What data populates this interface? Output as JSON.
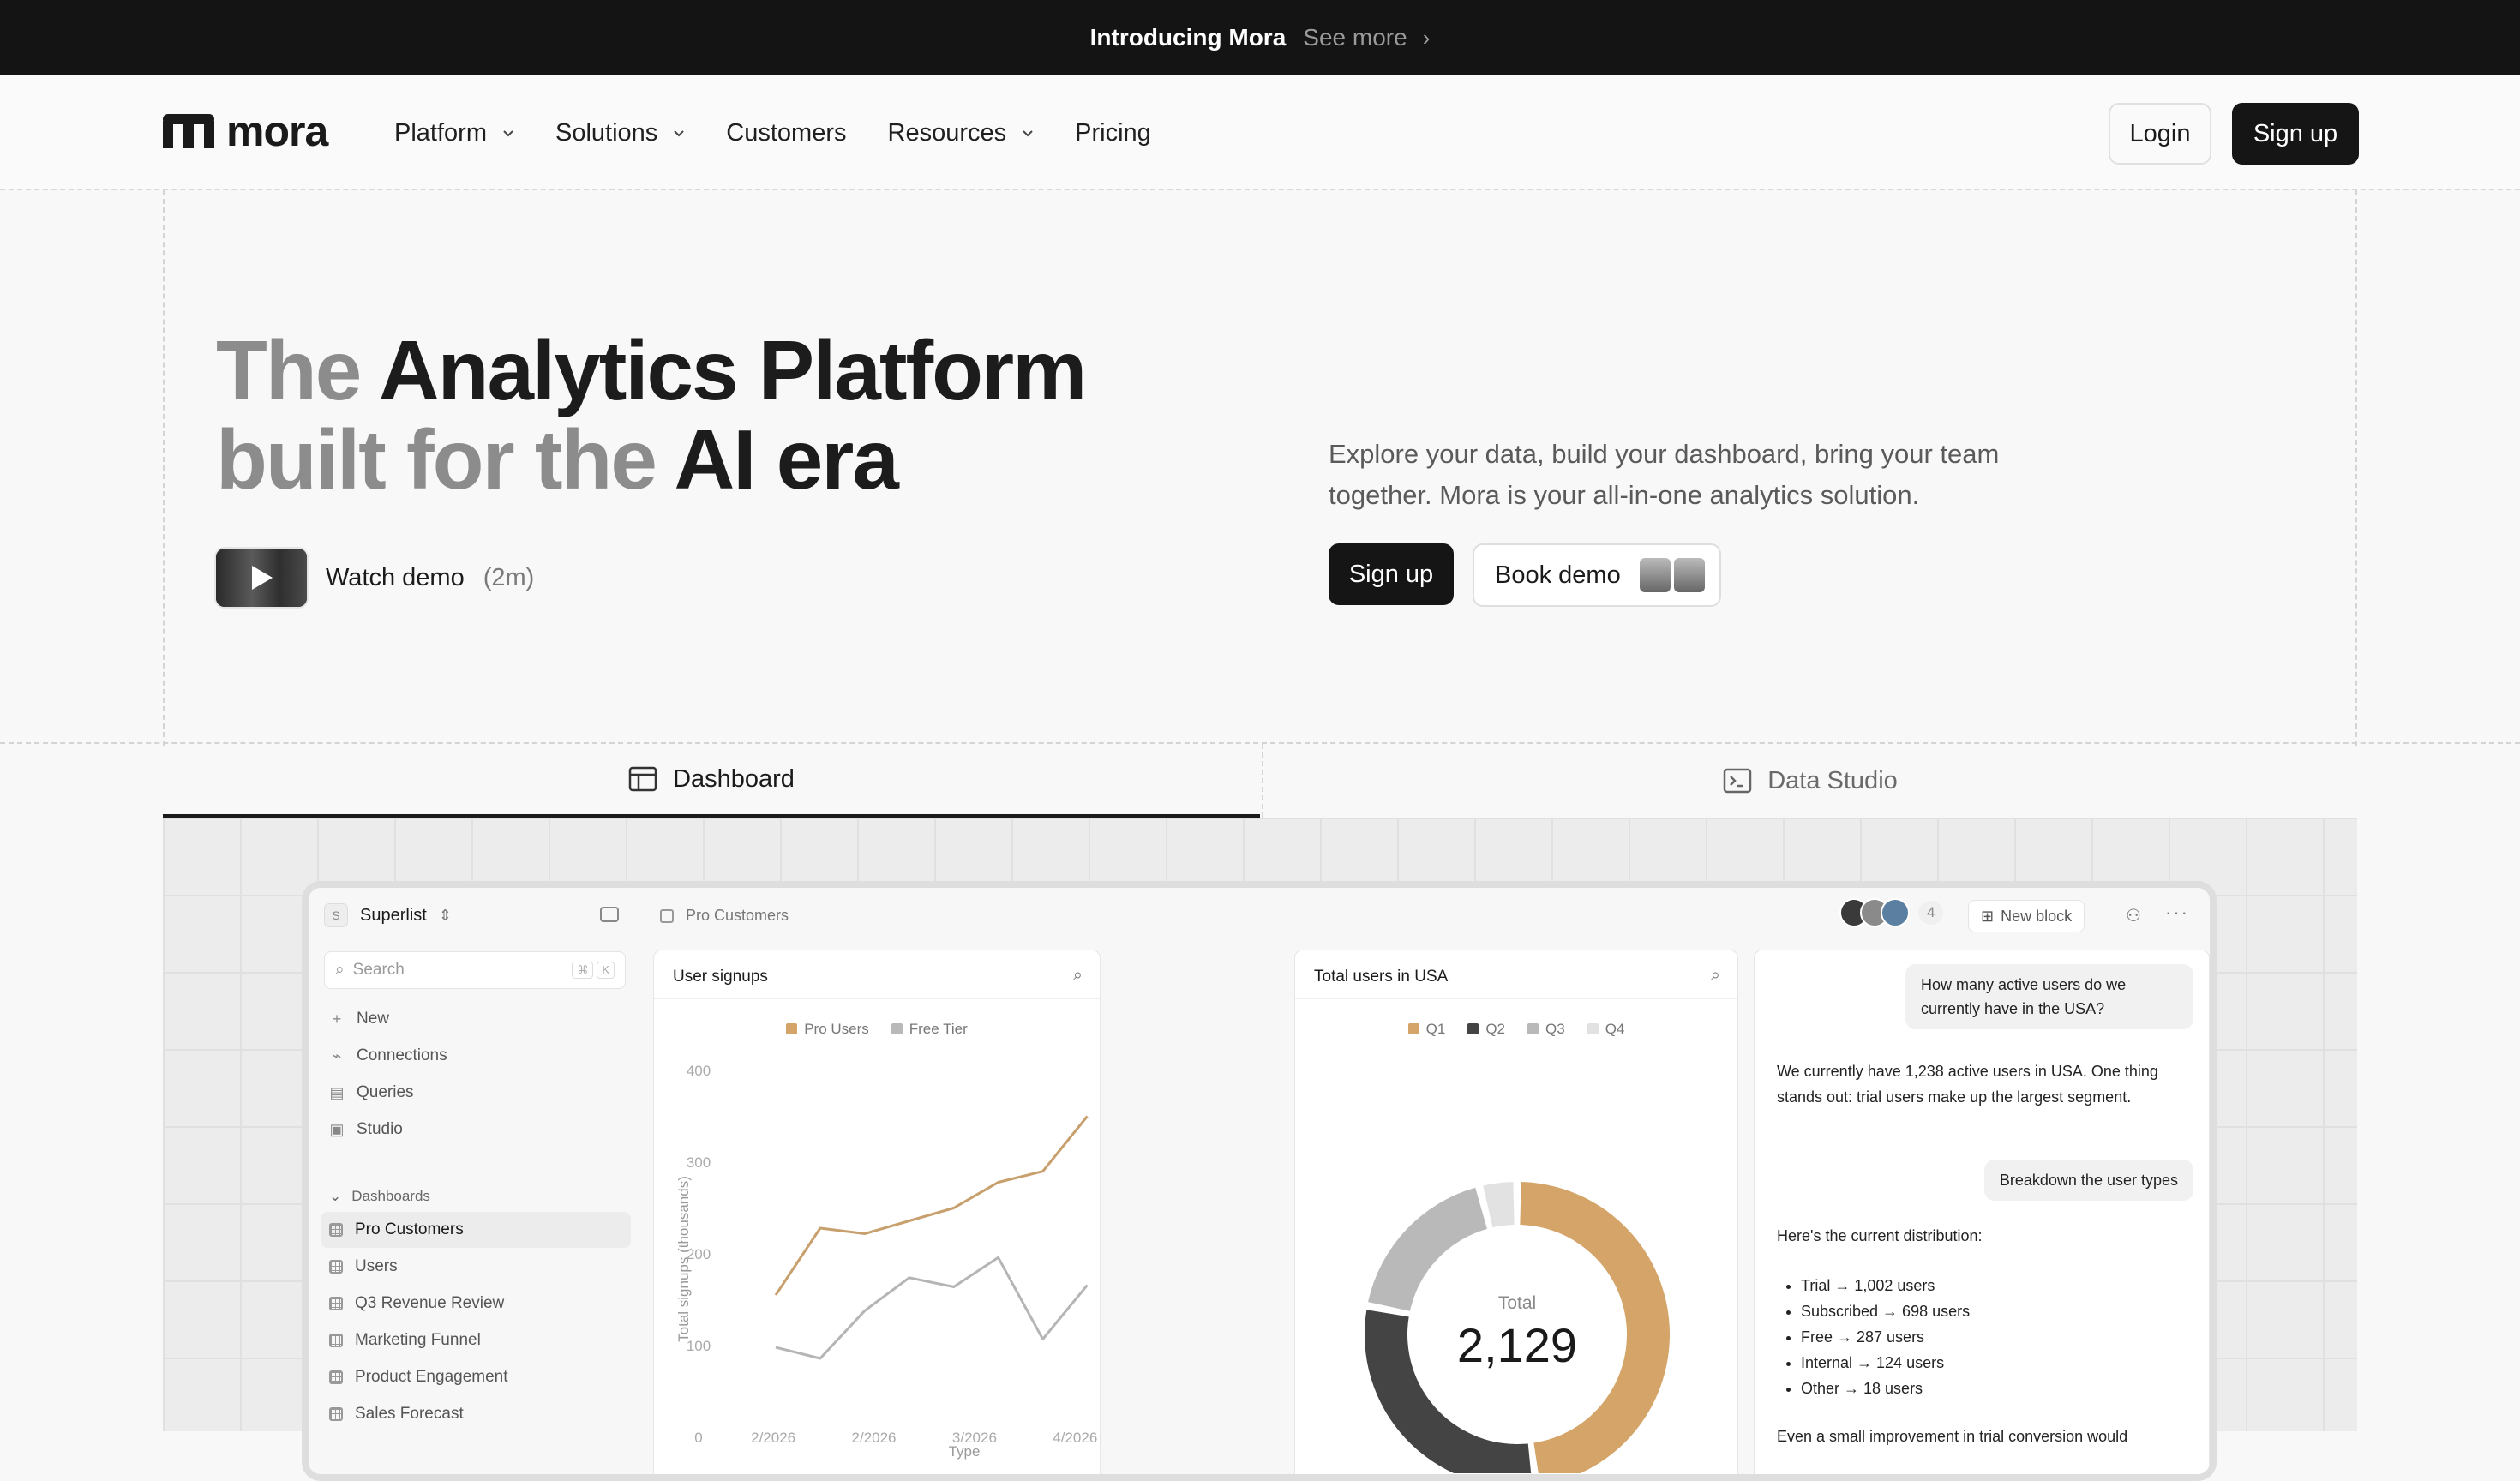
{
  "announcement": {
    "intro": "Introducing Mora",
    "link": "See more"
  },
  "nav": {
    "logo": "mora",
    "items": [
      {
        "label": "Platform",
        "dropdown": true
      },
      {
        "label": "Solutions",
        "dropdown": true
      },
      {
        "label": "Customers",
        "dropdown": false
      },
      {
        "label": "Resources",
        "dropdown": true
      },
      {
        "label": "Pricing",
        "dropdown": false
      }
    ],
    "login": "Login",
    "signup": "Sign up"
  },
  "hero": {
    "line1_light": "The",
    "line1_dark": "Analytics Platform",
    "line2_light": "built for the",
    "line2_dark": "AI era",
    "watch_label": "Watch demo",
    "watch_duration": "(2m)",
    "description": "Explore your data, build your dashboard, bring your team together. Mora is your all-in-one analytics solution.",
    "signup": "Sign up",
    "book_demo": "Book demo"
  },
  "tabs": [
    {
      "label": "Dashboard",
      "active": true,
      "icon": "layout-icon"
    },
    {
      "label": "Data Studio",
      "active": false,
      "icon": "terminal-icon"
    }
  ],
  "app": {
    "workspace": "Superlist",
    "workspace_initial": "S",
    "search_placeholder": "Search",
    "search_keys": [
      "⌘",
      "K"
    ],
    "nav": [
      {
        "label": "New",
        "icon": "plus-icon"
      },
      {
        "label": "Connections",
        "icon": "plug-icon"
      },
      {
        "label": "Queries",
        "icon": "query-icon"
      },
      {
        "label": "Studio",
        "icon": "terminal-icon"
      }
    ],
    "dashboards_heading": "Dashboards",
    "dashboards": [
      "Pro Customers",
      "Users",
      "Q3 Revenue Review",
      "Marketing Funnel",
      "Product Engagement",
      "Sales Forecast"
    ],
    "selected_dashboard": "Pro Customers",
    "breadcrumb": "Pro Customers",
    "collaborator_count": "4",
    "new_block": "New block"
  },
  "chart_data": [
    {
      "type": "line",
      "title": "User signups",
      "ylabel": "Total signups (thousands)",
      "xlabel": "Type",
      "ylim": [
        0,
        400
      ],
      "yticks": [
        "400",
        "300",
        "200",
        "100",
        "0"
      ],
      "xticks": [
        "2/2026",
        "2/2026",
        "3/2026",
        "4/2026"
      ],
      "series": [
        {
          "name": "Pro Users",
          "color": "#c8a06e",
          "values": [
            155,
            228,
            222,
            236,
            250,
            278,
            290,
            350
          ]
        },
        {
          "name": "Free Tier",
          "color": "#b5b5b5",
          "values": [
            98,
            86,
            138,
            174,
            164,
            196,
            107,
            166
          ]
        }
      ]
    },
    {
      "type": "pie",
      "title": "Total users in USA",
      "center_label": "Total",
      "center_value": "2,129",
      "slices": [
        {
          "name": "Q1",
          "color": "#d4a468",
          "value": 48
        },
        {
          "name": "Q2",
          "color": "#444444",
          "value": 30
        },
        {
          "name": "Q3",
          "color": "#b9b9b9",
          "value": 18
        },
        {
          "name": "Q4",
          "color": "#e2e2e2",
          "value": 4
        }
      ]
    }
  ],
  "chat": {
    "q1": "How many active users do we currently have in the USA?",
    "a1": "We currently have 1,238 active users in USA. One thing stands out: trial users make up the largest segment.",
    "q2": "Breakdown the user types",
    "a2_intro": "Here's the current distribution:",
    "a2_items": [
      "Trial → 1,002 users",
      "Subscribed → 698 users",
      "Free → 287 users",
      "Internal → 124 users",
      "Other → 18 users"
    ],
    "a2_outro": "Even a small improvement in trial conversion would"
  }
}
